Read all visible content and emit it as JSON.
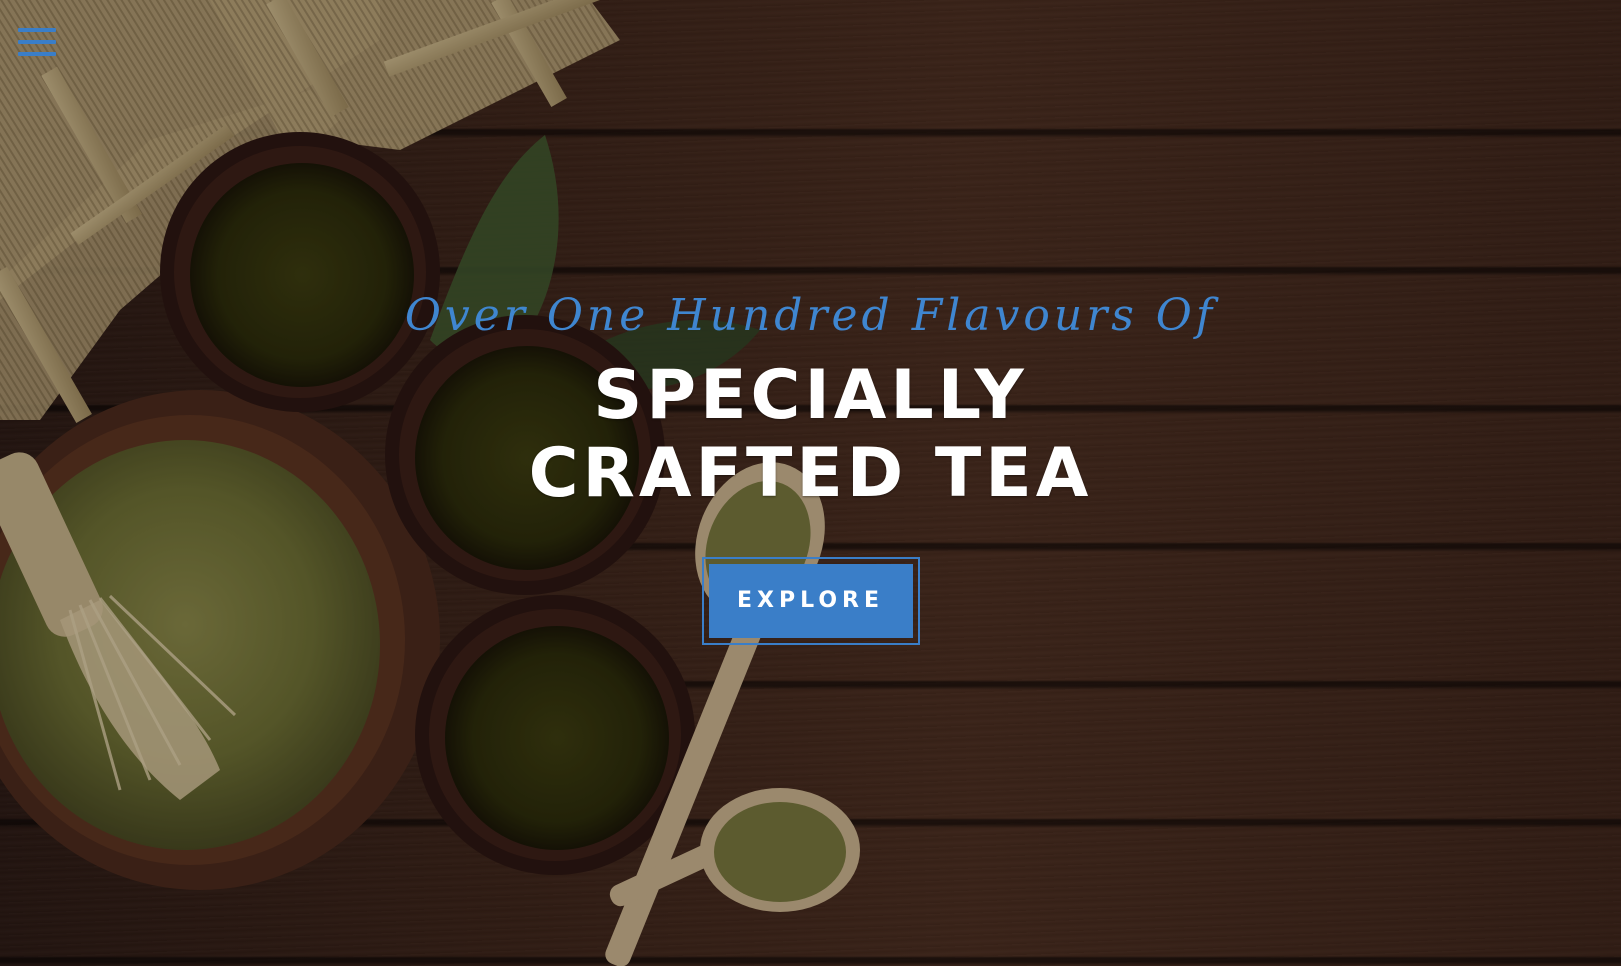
{
  "nav": {
    "menu_icon": "hamburger-menu-icon"
  },
  "hero": {
    "tagline": "Over One Hundred Flavours Of",
    "headline_line1": "SPECIALLY",
    "headline_line2": "CRAFTED TEA",
    "cta_label": "EXPLORE",
    "background_image": "matcha tea cups, powder bowl, whisk and wooden spoons on dark wood table"
  },
  "colors": {
    "accent": "#3a7ec8",
    "headline": "#ffffff",
    "background": "#3b2419"
  }
}
